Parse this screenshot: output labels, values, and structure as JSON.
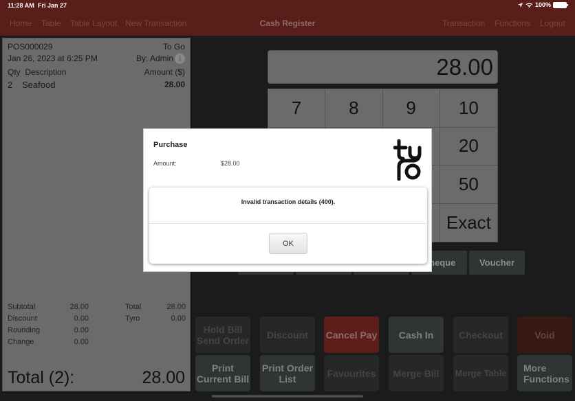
{
  "status_bar": {
    "time": "11:28 AM",
    "date": "Fri Jan 27",
    "battery": "100%",
    "icons": [
      "location-arrow-icon",
      "wifi-icon",
      "battery-icon"
    ]
  },
  "nav": {
    "title": "Cash Register",
    "left_links": [
      "Home",
      "Table",
      "Table Layout",
      "New Transaction"
    ],
    "right_links": [
      "Transaction",
      "Functions",
      "Logout"
    ]
  },
  "receipt": {
    "order_id": "POS000029",
    "order_type": "To Go",
    "datetime": "Jan 26, 2023 at 6:25 PM",
    "by": "By: Admin",
    "info_icon": "info-icon",
    "headers": {
      "qty": "Qty",
      "description": "Description",
      "amount": "Amount ($)"
    },
    "items": [
      {
        "qty": "2",
        "description": "Seafood",
        "amount": "28.00"
      }
    ],
    "summary_left": [
      {
        "label": "Subtotal",
        "value": "28.00"
      },
      {
        "label": "Discount",
        "value": "0.00"
      },
      {
        "label": "Rounding",
        "value": "0.00"
      },
      {
        "label": "Change",
        "value": "0.00"
      }
    ],
    "summary_right": [
      {
        "label": "Total",
        "value": "28.00"
      },
      {
        "label": "Tyro",
        "value": "0.00"
      }
    ],
    "grand_total_label": "Total (2):",
    "grand_total_value": "28.00"
  },
  "payment": {
    "display_value": "28.00",
    "keys": [
      "7",
      "8",
      "9",
      "10",
      "",
      "",
      "",
      "20",
      "",
      "",
      "",
      "50",
      "",
      "",
      "",
      "Exact"
    ],
    "methods": [
      "",
      "",
      "",
      "Cheque",
      "Voucher"
    ]
  },
  "functions": {
    "row1": [
      "Hold Bill\nSend Order",
      "Discount",
      "Cancel Pay",
      "Cash In",
      "Checkout",
      "Void"
    ],
    "row2": [
      "Print\nCurrent Bill",
      "Print Order\nList",
      "Favourites",
      "Merge Bill",
      "Merge Table",
      "More\nFunctions"
    ]
  },
  "dialog": {
    "title": "Purchase",
    "amount_label": "Amount:",
    "amount_value": "$28.00",
    "brand": "tyro",
    "alert_message": "Invalid transaction details (400).",
    "ok_label": "OK"
  },
  "colors": {
    "brand_red": "#5a1e1a",
    "panel_gray": "#6b6b6b",
    "background": "#1b1b1b"
  }
}
